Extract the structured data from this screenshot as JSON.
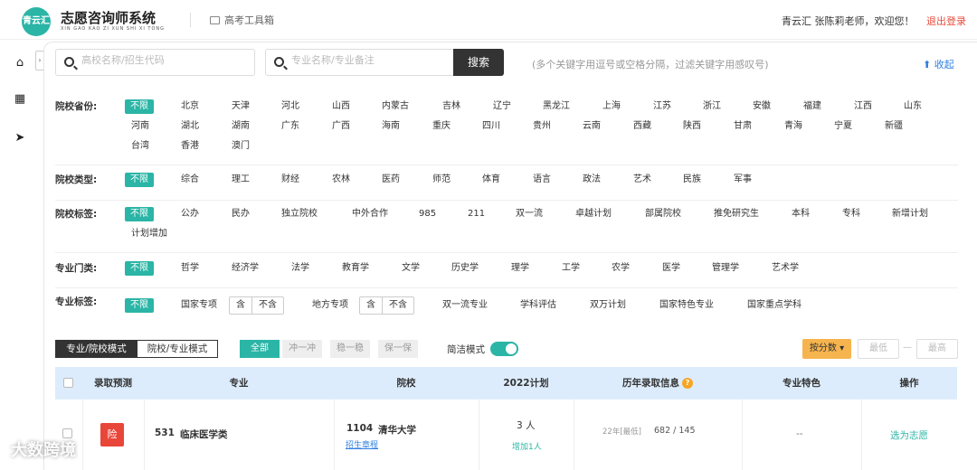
{
  "app": {
    "logo_text": "青云汇",
    "title": "志愿咨询师系统",
    "subtitle": "XIN GAO KAO ZI XUN SHI XI TONG",
    "toolbox_label": "高考工具箱",
    "greeting": "青云汇 张陈莉老师，欢迎您！",
    "logout_label": "退出登录"
  },
  "sidebar": {
    "items": [
      {
        "name": "home-icon",
        "glyph": "⌂"
      },
      {
        "name": "grid-icon",
        "glyph": "▦"
      },
      {
        "name": "send-icon",
        "glyph": "➤"
      }
    ],
    "collapse_glyph": "›"
  },
  "search": {
    "school_placeholder": "高校名称/招生代码",
    "major_placeholder": "专业名称/专业备注",
    "button_label": "搜索",
    "hint": "(多个关键字用逗号或空格分隔，过滤关键字用感叹号)",
    "collapse_label": "⬆ 收起"
  },
  "filters": {
    "province": {
      "label": "院校省份:",
      "options": [
        "不限",
        "北京",
        "天津",
        "河北",
        "山西",
        "内蒙古",
        "吉林",
        "辽宁",
        "黑龙江",
        "上海",
        "江苏",
        "浙江",
        "安徽",
        "福建",
        "江西",
        "山东",
        "河南",
        "湖北",
        "湖南",
        "广东",
        "广西",
        "海南",
        "重庆",
        "四川",
        "贵州",
        "云南",
        "西藏",
        "陕西",
        "甘肃",
        "青海",
        "宁夏",
        "新疆",
        "台湾",
        "香港",
        "澳门"
      ]
    },
    "type": {
      "label": "院校类型:",
      "options": [
        "不限",
        "综合",
        "理工",
        "财经",
        "农林",
        "医药",
        "师范",
        "体育",
        "语言",
        "政法",
        "艺术",
        "民族",
        "军事"
      ]
    },
    "tags": {
      "label": "院校标签:",
      "options": [
        "不限",
        "公办",
        "民办",
        "独立院校",
        "中外合作",
        "985",
        "211",
        "双一流",
        "卓越计划",
        "部属院校",
        "推免研究生",
        "本科",
        "专科",
        "新增计划",
        "计划增加"
      ]
    },
    "category": {
      "label": "专业门类:",
      "options": [
        "不限",
        "哲学",
        "经济学",
        "法学",
        "教育学",
        "文学",
        "历史学",
        "理学",
        "工学",
        "农学",
        "医学",
        "管理学",
        "艺术学"
      ]
    },
    "major_tags": {
      "label": "专业标签:",
      "all": "不限",
      "national": "国家专项",
      "local": "地方专项",
      "include": "含",
      "exclude": "不含",
      "options": [
        "双一流专业",
        "学科评估",
        "双万计划",
        "国家特色专业",
        "国家重点学科"
      ]
    }
  },
  "toolbar": {
    "mode_major": "专业/院校模式",
    "mode_school": "院校/专业模式",
    "risk_all": "全部",
    "risk_rush": "冲一冲",
    "risk_stable": "稳一稳",
    "risk_safe": "保一保",
    "simple_mode": "简洁模式",
    "sort_label": "按分数 ▾",
    "min_placeholder": "最低",
    "max_placeholder": "最高",
    "range_sep": "—"
  },
  "table": {
    "headers": [
      "录取预测",
      "专业",
      "院校",
      "2022计划",
      "历年录取信息",
      "专业特色",
      "操作"
    ],
    "help_glyph": "?",
    "rows": [
      {
        "risk": "险",
        "major_code": "531",
        "major_name": "临床医学类",
        "school_code": "1104",
        "school_name": "清华大学",
        "school_link": "招生章程",
        "plan": "3 人",
        "plan_note": "增加1人",
        "history": "22年[最低]",
        "history_value": "682 / 145",
        "feature": "--",
        "action": "选为志愿"
      }
    ]
  },
  "watermark": "大数跨境",
  "colors": {
    "accent": "#2bb5a6",
    "danger": "#e9463a",
    "link": "#2f7fe0",
    "header_bg": "#dcecfc",
    "sort_btn": "#f6b44f"
  }
}
